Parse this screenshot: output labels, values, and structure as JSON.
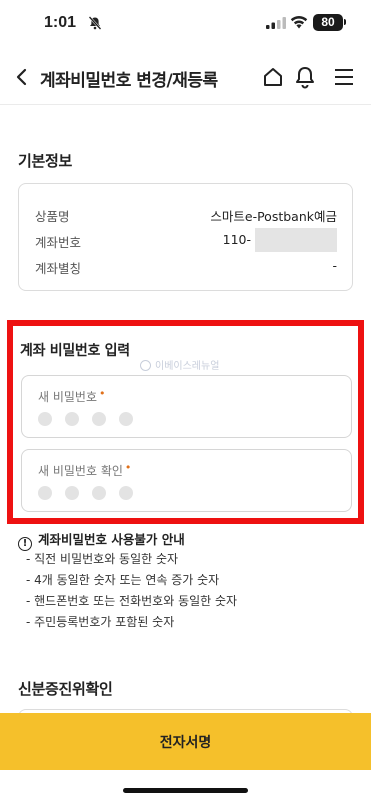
{
  "status_bar": {
    "time": "1:01",
    "battery": "80"
  },
  "header": {
    "title": "계좌비밀번호 변경/재등록",
    "icons": [
      "back-arrow-icon",
      "home-icon",
      "bell-icon",
      "hamburger-menu-icon"
    ]
  },
  "basic_info": {
    "section_title": "기본정보",
    "rows": [
      {
        "label": "상품명",
        "value": "스마트e-Postbank예금"
      },
      {
        "label": "계좌번호",
        "value": "110-"
      },
      {
        "label": "계좌별칭",
        "value": "-"
      }
    ]
  },
  "password": {
    "section_title": "계좌 비밀번호 입력",
    "watermark": "이베이스레뉴얼",
    "new_label": "새 비밀번호",
    "confirm_label": "새 비밀번호 확인",
    "required_mark": "•",
    "highlight_color": "#ee1111"
  },
  "guide": {
    "title": "계좌비밀번호 사용불가 안내",
    "items": [
      "- 직전 비밀번호와 동일한 숫자",
      "- 4개 동일한 숫자 또는 연속 증가 숫자",
      "- 핸드폰번호 또는 전화번호와 동일한 숫자",
      "- 주민등록번호가 포함된 숫자"
    ]
  },
  "identity": {
    "section_title": "신분증진위확인"
  },
  "footer": {
    "sign_button": "전자서명",
    "accent_color": "#f5c02b"
  }
}
